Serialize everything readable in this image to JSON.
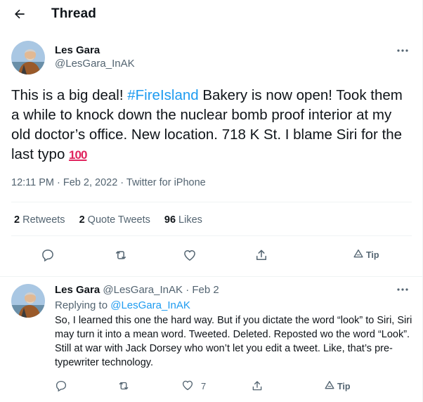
{
  "header": {
    "title": "Thread"
  },
  "tweet": {
    "author_name": "Les Gara",
    "author_handle": "@LesGara_InAK",
    "text_before": "This is a big deal! ",
    "hashtag": "#FireIsland",
    "text_after": " Bakery is now open! Took them a while to knock down the nuclear bomb proof interior at my old doctor’s office. New location. 718 K St. I blame Siri for the last typo ",
    "emoji": "100",
    "meta": "12:11 PM · Feb 2, 2022 · Twitter for iPhone",
    "stats": {
      "retweets_count": "2",
      "retweets_label": " Retweets",
      "quotes_count": "2",
      "quotes_label": " Quote Tweets",
      "likes_count": "96",
      "likes_label": " Likes"
    },
    "tip_label": "Tip"
  },
  "reply": {
    "author_name": "Les Gara",
    "author_handle": "@LesGara_InAK",
    "date": "· Feb 2",
    "replying_prefix": "Replying to ",
    "replying_handle": "@LesGara_InAK",
    "text": "So, I learned this one the hard way. But if you dictate the word “look” to Siri, Siri may turn it into a mean word. Tweeted. Deleted. Reposted wo the word “Look”. Still at war with Jack Dorsey who won’t let you edit a tweet. Like, that’s pre-typewriter technology.",
    "like_count": "7",
    "tip_label": "Tip"
  },
  "colors": {
    "accent": "#1d9bf0",
    "secondary": "#536471",
    "primary": "#0f1419",
    "divider": "#eff3f4"
  },
  "icons": [
    "back-arrow-icon",
    "more-icon",
    "reply-icon",
    "retweet-icon",
    "like-icon",
    "share-icon",
    "tip-icon"
  ]
}
